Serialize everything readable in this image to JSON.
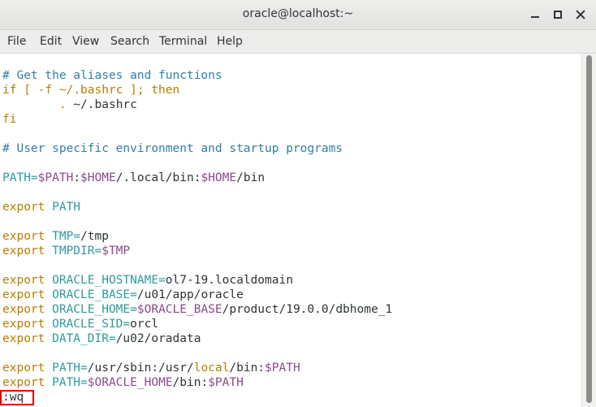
{
  "window": {
    "title": "oracle@localhost:~"
  },
  "menu": [
    "File",
    "Edit",
    "View",
    "Search",
    "Terminal",
    "Help"
  ],
  "editor": {
    "lines": [
      {
        "segments": [
          {
            "t": "# Get the aliases and functions",
            "c": "comment"
          }
        ]
      },
      {
        "segments": [
          {
            "t": "if [ -f ~/.bashrc ]; then",
            "c": "kw"
          }
        ]
      },
      {
        "segments": [
          {
            "t": "        . ",
            "c": "kw"
          },
          {
            "t": "~/.bashrc",
            "c": "plain"
          }
        ]
      },
      {
        "segments": [
          {
            "t": "fi",
            "c": "kw"
          }
        ]
      },
      {
        "segments": []
      },
      {
        "segments": [
          {
            "t": "# User specific environment and startup programs",
            "c": "comment"
          }
        ]
      },
      {
        "segments": []
      },
      {
        "segments": [
          {
            "t": "PATH=",
            "c": "var"
          },
          {
            "t": "$PATH",
            "c": "dollar"
          },
          {
            "t": ":",
            "c": "plain"
          },
          {
            "t": "$HOME",
            "c": "dollar"
          },
          {
            "t": "/.local/bin:",
            "c": "plain"
          },
          {
            "t": "$HOME",
            "c": "dollar"
          },
          {
            "t": "/bin",
            "c": "plain"
          }
        ]
      },
      {
        "segments": []
      },
      {
        "segments": [
          {
            "t": "export ",
            "c": "kw"
          },
          {
            "t": "PATH",
            "c": "var"
          }
        ]
      },
      {
        "segments": []
      },
      {
        "segments": [
          {
            "t": "export ",
            "c": "kw"
          },
          {
            "t": "TMP=",
            "c": "var"
          },
          {
            "t": "/tmp",
            "c": "plain"
          }
        ]
      },
      {
        "segments": [
          {
            "t": "export ",
            "c": "kw"
          },
          {
            "t": "TMPDIR=",
            "c": "var"
          },
          {
            "t": "$TMP",
            "c": "dollar"
          }
        ]
      },
      {
        "segments": []
      },
      {
        "segments": [
          {
            "t": "export ",
            "c": "kw"
          },
          {
            "t": "ORACLE_HOSTNAME=",
            "c": "var"
          },
          {
            "t": "ol7-19.localdomain",
            "c": "plain"
          }
        ]
      },
      {
        "segments": [
          {
            "t": "export ",
            "c": "kw"
          },
          {
            "t": "ORACLE_BASE=",
            "c": "var"
          },
          {
            "t": "/u01/app/oracle",
            "c": "plain"
          }
        ]
      },
      {
        "segments": [
          {
            "t": "export ",
            "c": "kw"
          },
          {
            "t": "ORACLE_HOME=",
            "c": "var"
          },
          {
            "t": "$ORACLE_BASE",
            "c": "dollar"
          },
          {
            "t": "/product/19.0.0/dbhome_1",
            "c": "plain"
          }
        ]
      },
      {
        "segments": [
          {
            "t": "export ",
            "c": "kw"
          },
          {
            "t": "ORACLE_SID=",
            "c": "var"
          },
          {
            "t": "orcl",
            "c": "plain"
          }
        ]
      },
      {
        "segments": [
          {
            "t": "export ",
            "c": "kw"
          },
          {
            "t": "DATA_DIR=",
            "c": "var"
          },
          {
            "t": "/u02/oradata",
            "c": "plain"
          }
        ]
      },
      {
        "segments": []
      },
      {
        "segments": [
          {
            "t": "export ",
            "c": "kw"
          },
          {
            "t": "PATH=",
            "c": "var"
          },
          {
            "t": "/usr/sbin:/usr/",
            "c": "plain"
          },
          {
            "t": "local",
            "c": "kw"
          },
          {
            "t": "/bin:",
            "c": "plain"
          },
          {
            "t": "$PATH",
            "c": "dollar"
          }
        ]
      },
      {
        "segments": [
          {
            "t": "export ",
            "c": "kw"
          },
          {
            "t": "PATH=",
            "c": "var"
          },
          {
            "t": "$ORACLE_HOME",
            "c": "dollar"
          },
          {
            "t": "/bin:",
            "c": "plain"
          },
          {
            "t": "$PATH",
            "c": "dollar"
          }
        ]
      },
      {
        "segments": [
          {
            "t": ":wq",
            "c": "plain"
          }
        ]
      }
    ]
  },
  "colors": {
    "comment": "#2f7fa5",
    "keyword": "#b77d00",
    "variable": "#2e9aa0",
    "dollar": "#8a4a8a",
    "highlight": "#e00000"
  }
}
